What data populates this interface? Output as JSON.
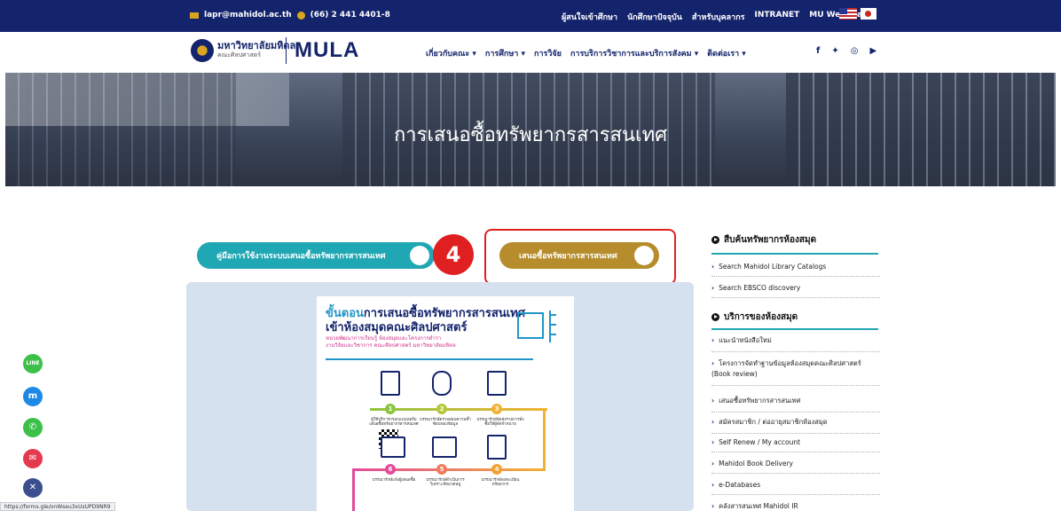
{
  "topbar": {
    "email": "lapr@mahidol.ac.th",
    "phone": "(66) 2 441 4401-8",
    "links": [
      "ผู้สนใจเข้าศึกษา",
      "นักศึกษาปัจจุบัน",
      "สำหรับบุคลากร",
      "INTRANET",
      "MU Web Mail"
    ]
  },
  "brand": {
    "uni_name": "มหาวิทยาลัยมหิดล",
    "faculty": "คณะศิลปศาสตร์",
    "mark": "MULA"
  },
  "menu": [
    "เกี่ยวกับคณะ ▾",
    "การศึกษา ▾",
    "การวิจัย",
    "การบริการวิชาการและบริการสังคม ▾",
    "ติดต่อเรา ▾"
  ],
  "social": [
    "f",
    "✦",
    "◎",
    "▶"
  ],
  "hero": {
    "title": "การเสนอซื้อทรัพยากรสารสนเทศ"
  },
  "buttons": {
    "manual": "คู่มือการใช้งานระบบเสนอซื้อทรัพยากรสารสนเทศ",
    "propose": "เสนอซื้อทรัพยากรสารสนเทศ",
    "step_number": "4"
  },
  "poster": {
    "title_hl": "ขั้นตอน",
    "title_rest": "การเสนอซื้อทรัพยากรสารสนเทศ",
    "title2": "เข้าห้องสมุดคณะศิลปศาสตร์",
    "sub1": "หน่วยพัฒนาการเรียนรู้ ห้องสมุดและโครงการตำรา",
    "sub2": "งานวิจัยและวิชาการ คณะศิลปศาสตร์ มหาวิทยาลัยมหิดล",
    "steps": [
      "1",
      "2",
      "3",
      "4",
      "5",
      "6"
    ],
    "captions": [
      "ผู้ใช้บริการกรอกแบบฟอร์มเสนอซื้อทรัพยากรสารสนเทศ",
      "บรรณารักษ์ตรวจสอบความซ้ำซ้อนของข้อมูล",
      "บรรณารักษ์จัดส่งรายการสั่งซื้อให้ผู้จัดจำหน่าย",
      "บรรณารักษ์ลงทะเบียนทรัพยากร",
      "บรรณารักษ์ดำเนินการวิเคราะห์หมวดหมู่",
      "บรรณารักษ์แจ้งผู้เสนอซื้อ"
    ]
  },
  "sidebar": {
    "section1": "สืบค้นทรัพยากรห้องสมุด",
    "section1_items": [
      "Search Mahidol Library Catalogs",
      "Search EBSCO discovery"
    ],
    "section2": "บริการของห้องสมุด",
    "section2_items": [
      "แนะนำหนังสือใหม่",
      "โครงการจัดทำฐานข้อมูลห้องสมุดคณะศิลปศาสตร์ (Book review)",
      "เสนอซื้อทรัพยากรสารสนเทศ",
      "สมัครสมาชิก / ต่ออายุสมาชิกห้องสมุด",
      "Self Renew / My account",
      "Mahidol Book Delivery",
      "e-Databases",
      "คลังสารสนเทศ Mahidol IR"
    ]
  },
  "floating": [
    "LINE",
    "m",
    "✆",
    "✉",
    "✕"
  ],
  "colors": {
    "navy": "#14246c",
    "teal": "#20a7b4",
    "gold": "#b68c2c",
    "highlight": "#e02020"
  },
  "status_url": "https://forms.gle/onWseu3xUsUPD9NR9"
}
